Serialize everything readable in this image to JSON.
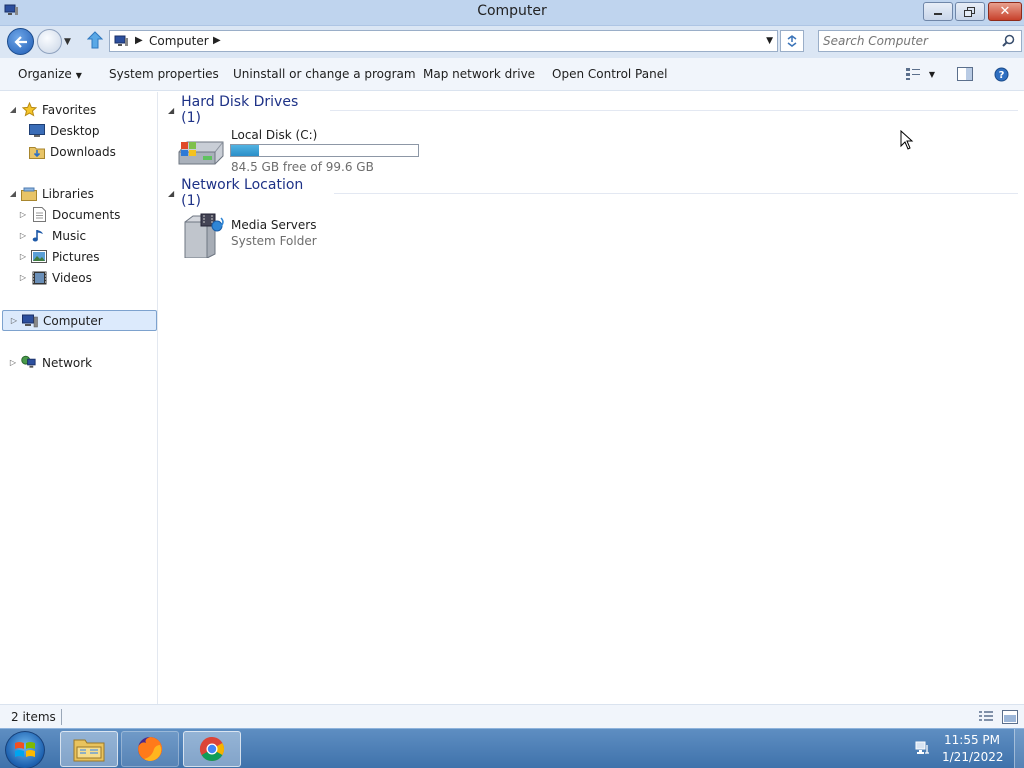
{
  "window": {
    "title": "Computer",
    "close_glyph": "✕"
  },
  "address_bar": {
    "crumbs": [
      "Computer"
    ],
    "search_placeholder": "Search Computer"
  },
  "toolbar": {
    "organize": "Organize",
    "system_properties": "System properties",
    "uninstall": "Uninstall or change a program",
    "map_drive": "Map network drive",
    "control_panel": "Open Control Panel"
  },
  "nav_pane": {
    "favorites": "Favorites",
    "desktop": "Desktop",
    "downloads": "Downloads",
    "libraries": "Libraries",
    "documents": "Documents",
    "music": "Music",
    "pictures": "Pictures",
    "videos": "Videos",
    "computer": "Computer",
    "network": "Network"
  },
  "content": {
    "groups": [
      {
        "title": "Hard Disk Drives (1)"
      },
      {
        "title": "Network Location (1)"
      }
    ],
    "drive": {
      "name": "Local Disk (C:)",
      "free_text": "84.5 GB free of 99.6 GB",
      "used_fraction": 0.152,
      "bar_color": "#2a8ec8"
    },
    "media_server": {
      "name": "Media Servers",
      "type": "System Folder"
    }
  },
  "status_bar": {
    "item_count": "2 items"
  },
  "taskbar": {
    "apps": [
      "file-explorer",
      "firefox",
      "chrome"
    ],
    "time": "11:55 PM",
    "date": "1/21/2022"
  },
  "colors": {
    "accent": "#1e3287",
    "selection": "#dceafc",
    "taskbar": "#3f72ab"
  }
}
